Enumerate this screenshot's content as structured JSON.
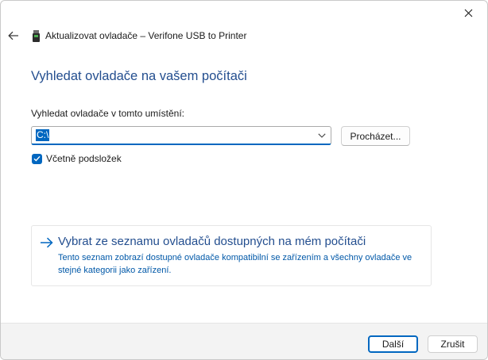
{
  "window": {
    "title": "Aktualizovat ovladače – Verifone USB to Printer",
    "close_icon": "close-icon",
    "back_icon": "back-arrow-icon",
    "device_icon": "usb-device-icon"
  },
  "main": {
    "heading": "Vyhledat ovladače na vašem počítači",
    "location_label": "Vyhledat ovladače v tomto umístění:",
    "path_value": "C:\\",
    "browse_label": "Procházet...",
    "include_subfolders_label": "Včetně podsložek",
    "include_subfolders_checked": true
  },
  "pick_option": {
    "icon": "arrow-right-icon",
    "title": "Vybrat ze seznamu ovladačů dostupných na mém počítači",
    "description": "Tento seznam zobrazí dostupné ovladače kompatibilní se zařízením a všechny ovladače ve stejné kategorii jako zařízení."
  },
  "footer": {
    "next_label": "Další",
    "cancel_label": "Zrušit"
  },
  "colors": {
    "accent": "#0067c0",
    "heading": "#234e8f",
    "link_text": "#0058a8",
    "footer_bg": "#f3f3f3"
  }
}
